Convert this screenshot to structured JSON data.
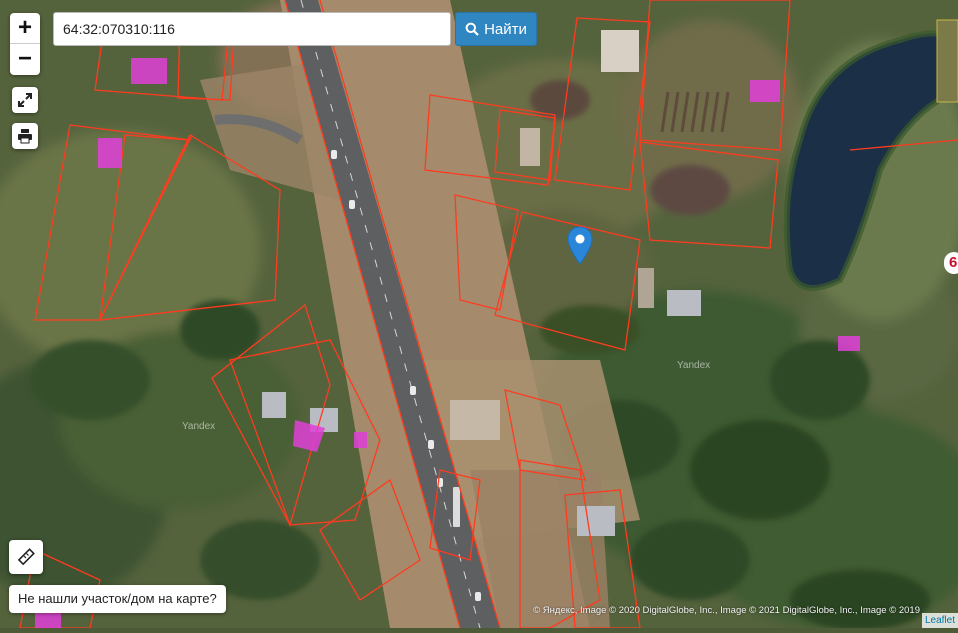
{
  "search": {
    "value": "64:32:070310:116",
    "button_label": "Найти"
  },
  "zoom": {
    "in_label": "+",
    "out_label": "−"
  },
  "controls": {
    "fullscreen_icon": "fullscreen-icon",
    "print_icon": "printer-icon",
    "ruler_icon": "ruler-icon"
  },
  "not_found_button": "Не нашли участок/дом на карте?",
  "attribution": "© Яндекс, Image © 2020 DigitalGlobe, Inc., Image © 2021 DigitalGlobe, Inc., Image © 2019",
  "leaflet_link": "Leaflet",
  "watermarks": [
    "Yandex",
    "Yandex"
  ],
  "edge_label": "6",
  "colors": {
    "parcel_border": "#ff3b1f",
    "building_highlight": "#e040d8",
    "marker": "#2a86d9",
    "search_button": "#2f86c1"
  }
}
